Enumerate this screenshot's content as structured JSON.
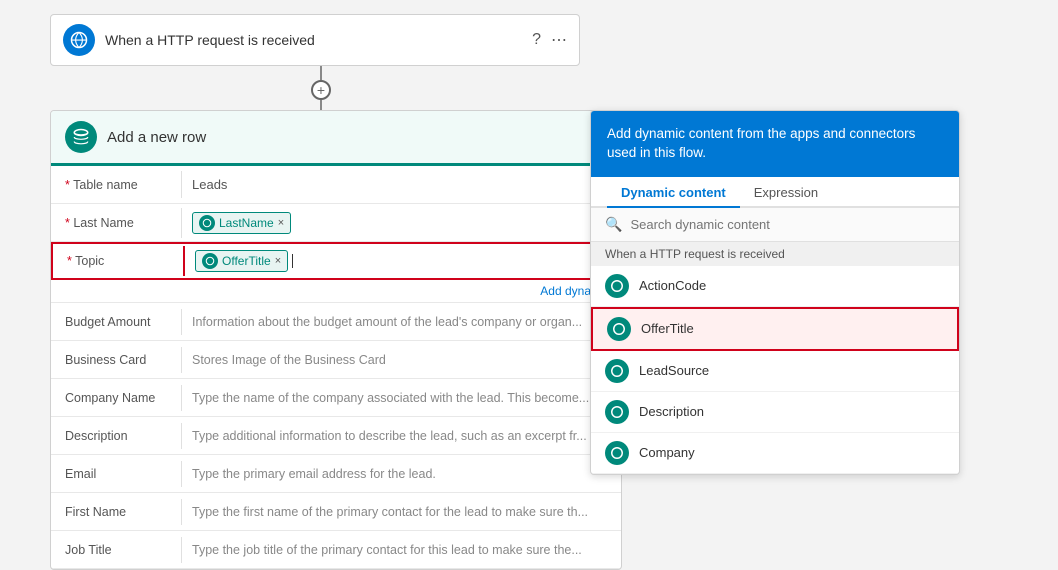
{
  "httpCard": {
    "title": "When a HTTP request is received",
    "iconLabel": "http-icon"
  },
  "addRowCard": {
    "title": "Add a new row",
    "iconLabel": "dataverse-icon",
    "fields": [
      {
        "label": "Table name",
        "required": true,
        "type": "plain",
        "value": "Leads"
      },
      {
        "label": "Last Name",
        "required": true,
        "type": "tag",
        "tag": "LastName"
      },
      {
        "label": "Topic",
        "required": true,
        "type": "tag-topic",
        "tag": "OfferTitle"
      },
      {
        "label": "Budget Amount",
        "required": false,
        "type": "placeholder",
        "value": "Information about the budget amount of the lead's company or organ..."
      },
      {
        "label": "Business Card",
        "required": false,
        "type": "placeholder",
        "value": "Stores Image of the Business Card"
      },
      {
        "label": "Company Name",
        "required": false,
        "type": "placeholder",
        "value": "Type the name of the company associated with the lead. This become..."
      },
      {
        "label": "Description",
        "required": false,
        "type": "placeholder",
        "value": "Type additional information to describe the lead, such as an excerpt fr..."
      },
      {
        "label": "Email",
        "required": false,
        "type": "placeholder",
        "value": "Type the primary email address for the lead."
      },
      {
        "label": "First Name",
        "required": false,
        "type": "placeholder",
        "value": "Type the first name of the primary contact for the lead to make sure th..."
      },
      {
        "label": "Job Title",
        "required": false,
        "type": "placeholder",
        "value": "Type the job title of the primary contact for this lead to make sure the..."
      }
    ],
    "addDynamicLink": "Add dynam..."
  },
  "dynamicPanel": {
    "header": "Add dynamic content from the apps and connectors used in this flow.",
    "tabs": [
      {
        "label": "Dynamic content",
        "active": true
      },
      {
        "label": "Expression",
        "active": false
      }
    ],
    "search": {
      "placeholder": "Search dynamic content"
    },
    "sectionLabel": "When a HTTP request is received",
    "items": [
      {
        "label": "ActionCode",
        "selected": false
      },
      {
        "label": "OfferTitle",
        "selected": true
      },
      {
        "label": "LeadSource",
        "selected": false
      },
      {
        "label": "Description",
        "selected": false
      },
      {
        "label": "Company",
        "selected": false
      }
    ]
  }
}
